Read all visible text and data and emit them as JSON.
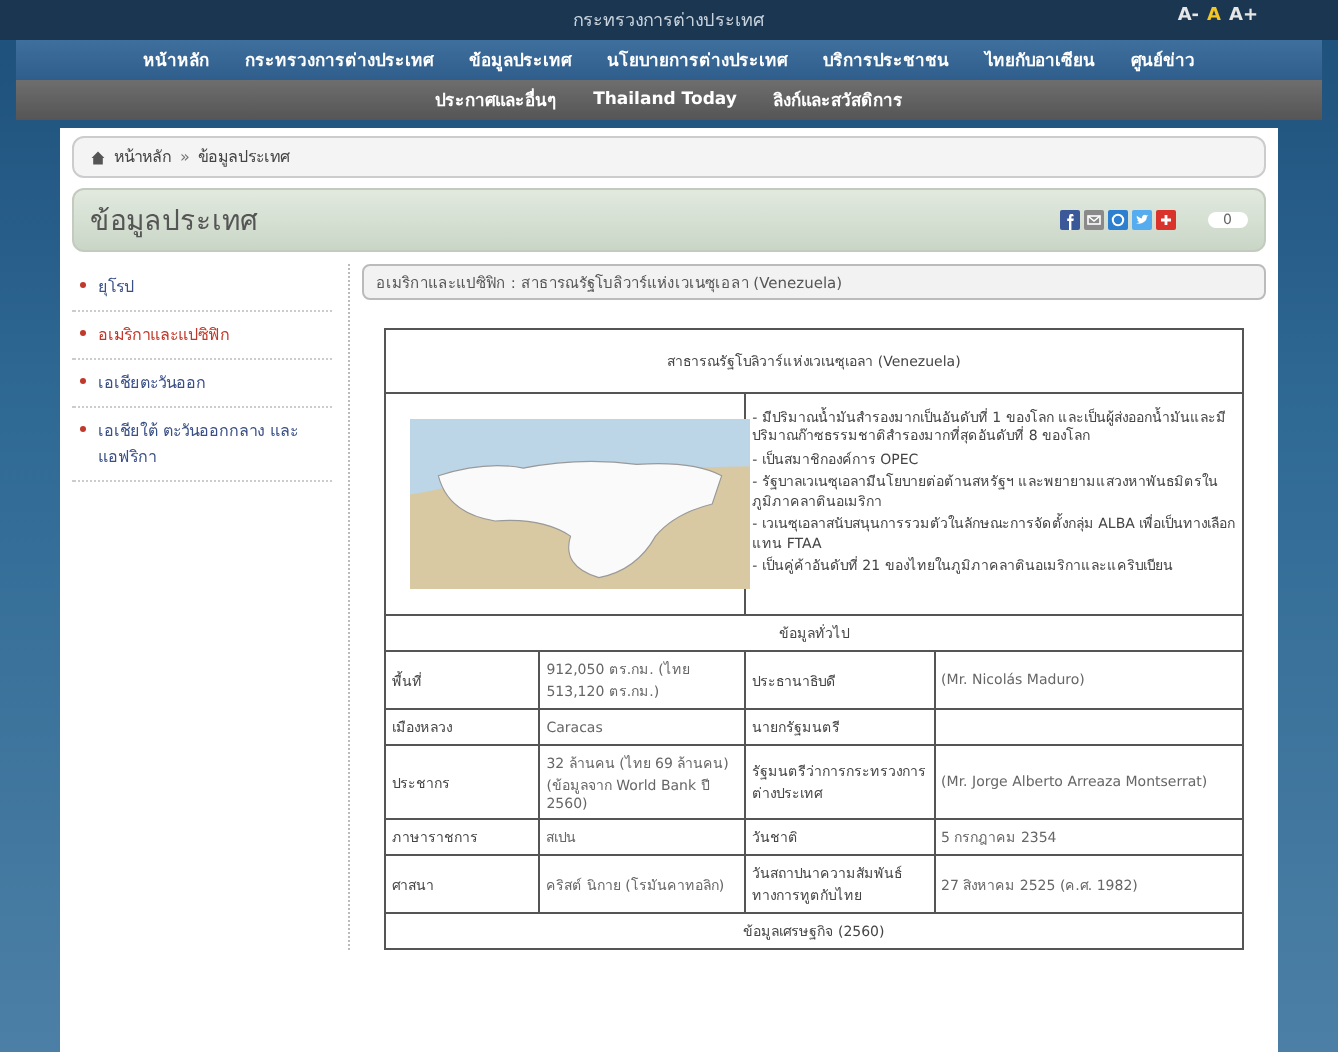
{
  "site_title": "กระทรวงการต่างประเทศ",
  "font_size_controls": [
    {
      "label": "A-",
      "selected": false
    },
    {
      "label": "A",
      "selected": true
    },
    {
      "label": "A+",
      "selected": false
    }
  ],
  "main_nav": [
    "หน้าหลัก",
    "กระทรวงการต่างประเทศ",
    "ข้อมูลประเทศ",
    "นโยบายการต่างประเทศ",
    "บริการประชาชน",
    "ไทยกับอาเซียน",
    "ศูนย์ข่าว"
  ],
  "sub_nav": [
    "ประกาศและอื่นๆ",
    "Thailand Today",
    "ลิงก์และสวัสดิการ"
  ],
  "breadcrumb": {
    "separator": "»",
    "items": [
      "หน้าหลัก",
      "ข้อมูลประเทศ"
    ]
  },
  "page_title": "ข้อมูลประเทศ",
  "share_buttons": [
    {
      "kind": "facebook"
    },
    {
      "kind": "email"
    },
    {
      "kind": "share"
    },
    {
      "kind": "twitter"
    },
    {
      "kind": "plus"
    }
  ],
  "share_count": "0",
  "sidebar": {
    "items": [
      {
        "label": "ยุโรป",
        "selected": false
      },
      {
        "label": "อเมริกาและแปซิฟิก",
        "selected": true
      },
      {
        "label": "เอเชียตะวันออก",
        "selected": false
      },
      {
        "label": "เอเชียใต้ ตะวันออกกลาง และแอฟริกา",
        "selected": false
      }
    ]
  },
  "content_header": "อเมริกาและแปซิฟิก : สาธารณรัฐโบลิวาร์แห่งเวเนซุเอลา (Venezuela)",
  "country_table": {
    "title": "สาธารณรัฐโบลิวาร์แห่งเวเนซุเอลา (Venezuela)",
    "highlights": [
      "- มีปริมาณน้ำมันสำรองมากเป็นอันดับที่ 1 ของโลก และเป็นผู้ส่งออกน้ำมันและมีปริมาณก๊าซธรรมชาติสำรองมากที่สุดอันดับที่ 8 ของโลก",
      "- เป็นสมาชิกองค์การ OPEC",
      "- รัฐบาลเวเนซุเอลามีนโยบายต่อต้านสหรัฐฯ และพยายามแสวงหาพันธมิตรในภูมิภาคลาตินอเมริกา",
      "- เวเนซุเอลาสนับสนุนการรวมตัวในลักษณะการจัดตั้งกลุ่ม ALBA เพื่อเป็นทางเลือกแทน FTAA",
      "- เป็นคู่ค้าอันดับที่ 21 ของไทยในภูมิภาคลาตินอเมริกาและแคริบเบียน"
    ],
    "general_heading": "ข้อมูลทั่วไป",
    "general_rows": [
      {
        "label_1": "พื้นที่",
        "value_1": "912,050 ตร.กม. (ไทย 513,120 ตร.กม.)",
        "label_2": "ประธานาธิบดี",
        "value_2": "(Mr. Nicolás  Maduro)"
      },
      {
        "label_1": "เมืองหลวง",
        "value_1": "Caracas",
        "label_2": "นายกรัฐมนตรี"
      },
      {
        "label_1": "ประชากร",
        "value_1": "32 ล้านคน (ไทย 69 ล้านคน) (ข้อมูลจาก World Bank ปี 2560)",
        "label_2": "รัฐมนตรีว่าการกระทรวงการต่างประเทศ",
        "value_2": "(Mr. Jorge Alberto Arreaza Montserrat)"
      },
      {
        "label_1": "ภาษาราชการ",
        "value_1": "สเปน",
        "label_2": "วันชาติ",
        "value_2": "5 กรกฎาคม 2354"
      },
      {
        "label_1": "ศาสนา",
        "value_1": "คริสต์ นิกาย (โรมันคาทอลิก)",
        "label_2": "วันสถาปนาความสัมพันธ์ทางการทูตกับไทย",
        "value_2": "27 สิงหาคม 2525 (ค.ศ. 1982)"
      }
    ],
    "economy_heading": "ข้อมูลเศรษฐกิจ (2560)"
  }
}
